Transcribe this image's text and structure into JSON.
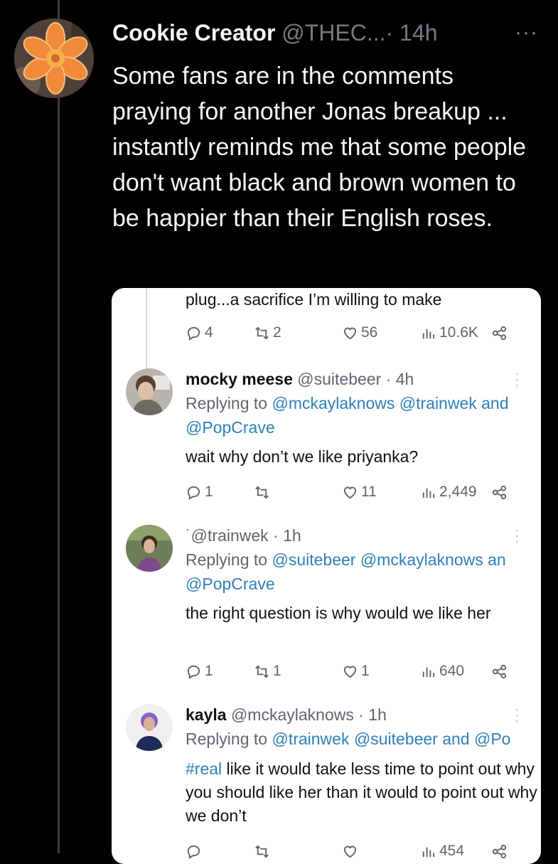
{
  "post": {
    "author_name": "Cookie Creator",
    "handle": "@THEC...",
    "time": "· 14h",
    "more": "···",
    "text": "Some fans are in the comments praying for another Jonas breakup ... instantly reminds me that some people don't want black and brown women to be happier than their English roses."
  },
  "card": {
    "top_text": "plug...a sacrifice I’m willing to make",
    "top_actions": {
      "replies": "4",
      "reposts": "2",
      "likes": "56",
      "views": "10.6K"
    },
    "replies": [
      {
        "name": "mocky meese",
        "handle": "@suitebeer",
        "time": "· 4h",
        "replying_prefix": "Replying to",
        "replying_line1": "@mckaylaknows @trainwek and",
        "replying_line2": "@PopCrave",
        "hashtag": "",
        "text": "wait why don’t we like priyanka?",
        "actions": {
          "replies": "1",
          "reposts": "",
          "likes": "11",
          "views": "2,449"
        }
      },
      {
        "name": "",
        "handle": "˙@trainwek",
        "time": "· 1h",
        "replying_prefix": "Replying to",
        "replying_line1": "@suitebeer @mckaylaknows an",
        "replying_line2": "@PopCrave",
        "hashtag": "",
        "text": "the right question is why would we like her",
        "actions": {
          "replies": "1",
          "reposts": "1",
          "likes": "1",
          "views": "640"
        }
      },
      {
        "name": "kayla",
        "handle": "@mckaylaknows",
        "time": "· 1h",
        "replying_prefix": "Replying to",
        "replying_line1": "@trainwek @suitebeer and @Po",
        "replying_line2": "",
        "hashtag": "#real",
        "text": " like it would take less time to point out why you should like her than it would to point out why we don’t",
        "actions": {
          "replies": "",
          "reposts": "",
          "likes": "",
          "views": "454"
        }
      }
    ]
  },
  "icons": {
    "reply": "reply-icon",
    "repost": "repost-icon",
    "like": "heart-icon",
    "views": "views-icon",
    "share": "share-icon",
    "more": "more-icon"
  },
  "colors": {
    "background": "#000000",
    "card": "#ffffff",
    "link": "#2f7fb8",
    "muted": "#60656b"
  }
}
